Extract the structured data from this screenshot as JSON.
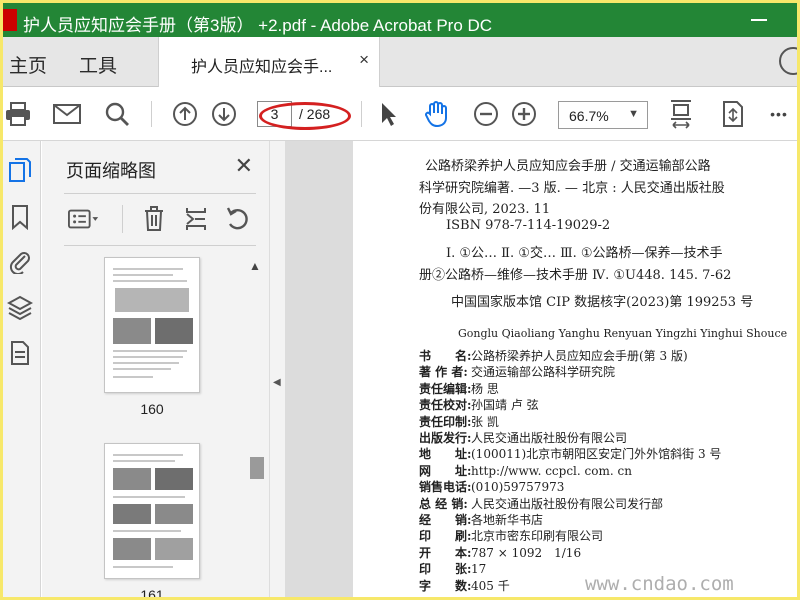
{
  "window": {
    "title": "护人员应知应会手册（第3版） +2.pdf - Adobe Acrobat Pro DC"
  },
  "nav": {
    "home": "主页",
    "tools": "工具"
  },
  "doc_tab": {
    "label": "护人员应知应会手...",
    "close": "×"
  },
  "toolbar": {
    "icons": [
      "print-icon",
      "mail-icon",
      "search-icon",
      "page-up-icon",
      "page-down-icon",
      "select-cursor-icon",
      "hand-tool-icon",
      "zoom-out-icon",
      "zoom-in-icon",
      "fit-page-icon",
      "scroll-mode-icon",
      "more-icon"
    ],
    "current_page": "3",
    "total_pages": "/ 268",
    "zoom": "66.7%",
    "more": "•••"
  },
  "panel": {
    "title": "页面缩略图",
    "thumbnails": [
      {
        "label": "160"
      },
      {
        "label": "161"
      }
    ]
  },
  "document": {
    "cip_lines": [
      "公路桥梁养护人员应知应会手册 / 交通运输部公路",
      "科学研究院编著. —3 版. — 北京 : 人民交通出版社股",
      "份有限公司, 2023. 11",
      "ISBN 978-7-114-19029-2",
      "Ⅰ. ①公… Ⅱ. ①交… Ⅲ. ①公路桥—保养—技术手",
      "册②公路桥—维修—技术手册 Ⅳ. ①U448. 145. 7-62",
      "中国国家版本馆 CIP 数据核字(2023)第 199253 号"
    ],
    "pinyin": "Gonglu Qiaoliang Yanghu Renyuan Yingzhi Yinghui Shouce",
    "bib": [
      {
        "k": "书　　名:",
        "v": "公路桥梁养护人员应知应会手册(第 3 版)"
      },
      {
        "k": "著 作 者:",
        "v": "交通运输部公路科学研究院"
      },
      {
        "k": "责任编辑:",
        "v": "杨 思"
      },
      {
        "k": "责任校对:",
        "v": "孙国靖 卢 弦"
      },
      {
        "k": "责任印制:",
        "v": "张 凯"
      },
      {
        "k": "出版发行:",
        "v": "人民交通出版社股份有限公司"
      },
      {
        "k": "地　　址:",
        "v": "(100011)北京市朝阳区安定门外外馆斜街 3 号"
      },
      {
        "k": "网　　址:",
        "v": "http://www. ccpcl. com. cn"
      },
      {
        "k": "销售电话:",
        "v": "(010)59757973"
      },
      {
        "k": "总 经 销:",
        "v": "人民交通出版社股份有限公司发行部"
      },
      {
        "k": "经　　销:",
        "v": "各地新华书店"
      },
      {
        "k": "印　　刷:",
        "v": "北京市密东印刷有限公司"
      },
      {
        "k": "开　　本:",
        "v": "787 × 1092　1/16"
      },
      {
        "k": "印　　张:",
        "v": "17"
      },
      {
        "k": "字　　数:",
        "v": "405 千"
      }
    ]
  },
  "watermark": "www.cndao.com",
  "colors": {
    "titlebar": "#238636",
    "accent_blue": "#1473e6",
    "highlight_red": "#d42020",
    "outer_border": "#f7e86a"
  }
}
